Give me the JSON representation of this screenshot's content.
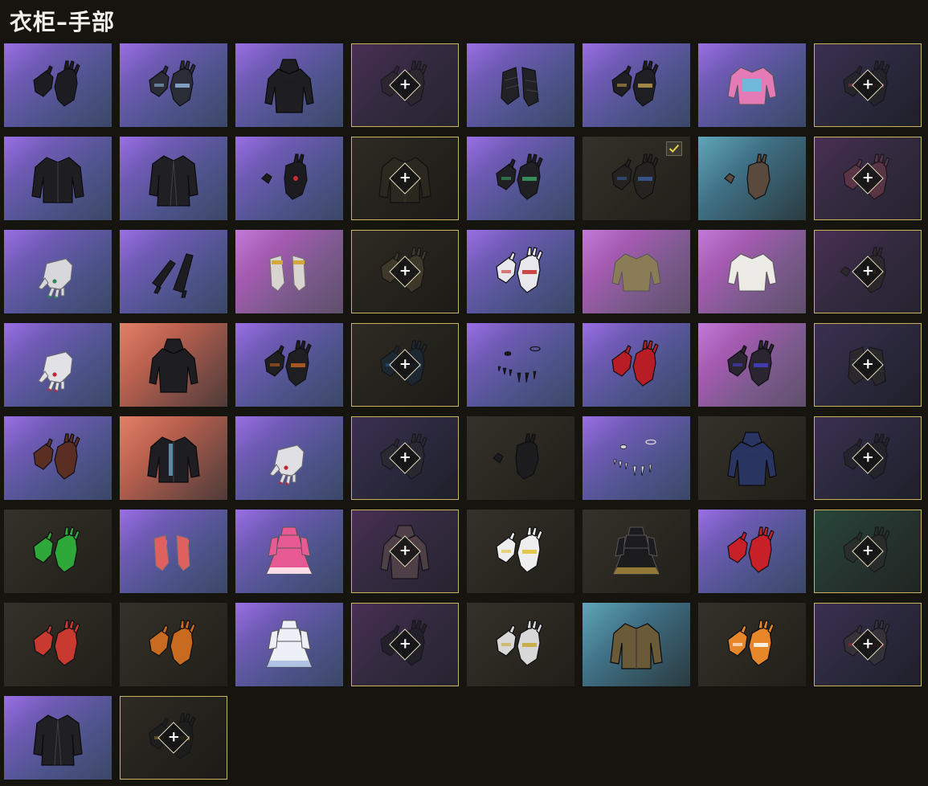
{
  "title": "衣柜–手部",
  "colors": {
    "locked_border": "#c9b45a",
    "accent_check": "#e8d046"
  },
  "items": [
    {
      "name": "black-gloves",
      "bg": "purple",
      "shape": "gloves",
      "color": "#1c1c22",
      "locked": false
    },
    {
      "name": "blue-cuff-gloves",
      "bg": "purple",
      "shape": "gloves",
      "color": "#2a2d38",
      "accent": "#8fb4d8",
      "locked": false
    },
    {
      "name": "hooded-bodysuit",
      "bg": "purple",
      "shape": "suit",
      "color": "#1d1d22",
      "locked": false
    },
    {
      "name": "locked-dark-gloves",
      "bg": "locked-purple",
      "shape": "gloves",
      "color": "#2a2528",
      "locked": true
    },
    {
      "name": "fingerless-sleeves",
      "bg": "purple",
      "shape": "sleeves",
      "color": "#222226",
      "locked": false
    },
    {
      "name": "gold-trim-gloves",
      "bg": "purple",
      "shape": "gloves",
      "color": "#1f1e22",
      "accent": "#b99a4c",
      "locked": false
    },
    {
      "name": "pink-crop-top",
      "bg": "purple",
      "shape": "top",
      "color": "#e47ab6",
      "accent": "#5dc4e0",
      "locked": false
    },
    {
      "name": "locked-ornate-gloves",
      "bg": "locked",
      "shape": "gloves",
      "color": "#232224",
      "accent": "#9a3c48",
      "locked": true
    },
    {
      "name": "black-leather-jacket",
      "bg": "purple",
      "shape": "jacket",
      "color": "#1e1e22",
      "locked": false
    },
    {
      "name": "long-black-coat",
      "bg": "purple",
      "shape": "coat",
      "color": "#1f1f24",
      "locked": false
    },
    {
      "name": "red-gem-glove",
      "bg": "purple",
      "shape": "glove-single",
      "color": "#1c1c20",
      "accent": "#c83030",
      "locked": false
    },
    {
      "name": "locked-camo-jacket",
      "bg": "locked-dark",
      "shape": "jacket",
      "color": "#2e2b22",
      "locked": true
    },
    {
      "name": "green-finger-gloves",
      "bg": "purple",
      "shape": "gloves",
      "color": "#202024",
      "accent": "#39a060",
      "locked": false
    },
    {
      "name": "gold-studded-gloves",
      "bg": "dark",
      "shape": "gloves",
      "color": "#24231f",
      "accent": "#3a5a9a",
      "locked": false,
      "equipped": true
    },
    {
      "name": "tan-fingerless-gloves",
      "bg": "teal",
      "shape": "glove-single",
      "color": "#5a4a3e",
      "locked": false
    },
    {
      "name": "locked-pink-gloves",
      "bg": "locked-purple",
      "shape": "gloves",
      "color": "#6a3a48",
      "locked": true
    },
    {
      "name": "white-hand-ring",
      "bg": "purple",
      "shape": "hand",
      "color": "#d8d8dc",
      "accent": "#2a8a5a",
      "locked": false
    },
    {
      "name": "long-black-gloves",
      "bg": "purple",
      "shape": "long-gloves",
      "color": "#1d1d21",
      "locked": false
    },
    {
      "name": "gold-bangle-hands",
      "bg": "pink",
      "shape": "hands",
      "color": "#d8d4d0",
      "accent": "#d4a83a",
      "locked": false
    },
    {
      "name": "locked-olive-gloves",
      "bg": "locked-dark",
      "shape": "gloves",
      "color": "#4a4230",
      "locked": true
    },
    {
      "name": "red-white-gloves",
      "bg": "purple",
      "shape": "gloves",
      "color": "#e8e8ec",
      "accent": "#c82a2a",
      "locked": false
    },
    {
      "name": "camo-tied-shirt",
      "bg": "pink",
      "shape": "top",
      "color": "#8a7c56",
      "locked": false
    },
    {
      "name": "white-tied-shirt",
      "bg": "pink",
      "shape": "top",
      "color": "#ecebe6",
      "locked": false
    },
    {
      "name": "locked-gold-wrap-glove",
      "bg": "locked-purple",
      "shape": "glove-single",
      "color": "#2a2722",
      "accent": "#9a8a4a",
      "locked": true
    },
    {
      "name": "white-hand-red-nails",
      "bg": "purple",
      "shape": "hand",
      "color": "#e2e2e6",
      "accent": "#c0283a",
      "locked": false
    },
    {
      "name": "hooded-jumpsuit",
      "bg": "orange",
      "shape": "suit",
      "color": "#1e1e22",
      "locked": false
    },
    {
      "name": "rainbow-knuckle-gloves",
      "bg": "purple",
      "shape": "gloves",
      "color": "#1f1f22",
      "accent": "#c06020",
      "locked": false
    },
    {
      "name": "locked-blue-gloves",
      "bg": "locked-dark",
      "shape": "gloves",
      "color": "#1a2a3c",
      "accent": "#2c6ab0",
      "locked": true
    },
    {
      "name": "claw-nails",
      "bg": "purple",
      "shape": "nails",
      "color": "#1a1a1e",
      "locked": false
    },
    {
      "name": "red-latex-gloves",
      "bg": "purple",
      "shape": "gloves",
      "color": "#b81c24",
      "locked": false
    },
    {
      "name": "purple-tip-gloves",
      "bg": "pink",
      "shape": "gloves",
      "color": "#2a2530",
      "accent": "#4a40c8",
      "locked": false
    },
    {
      "name": "locked-arm-guards",
      "bg": "locked",
      "shape": "sleeves",
      "color": "#2a2825",
      "locked": true
    },
    {
      "name": "brown-strap-gloves",
      "bg": "purple",
      "shape": "gloves",
      "color": "#5a2e22",
      "locked": false
    },
    {
      "name": "scarf-jacket",
      "bg": "orange",
      "shape": "jacket",
      "color": "#1e1e22",
      "accent": "#6ea0c8",
      "locked": false
    },
    {
      "name": "white-hand-ring-2",
      "bg": "purple",
      "shape": "hand",
      "color": "#e0e0e4",
      "accent": "#c0283a",
      "locked": false
    },
    {
      "name": "locked-grey-gloves",
      "bg": "locked",
      "shape": "gloves",
      "color": "#2a2a2e",
      "locked": true
    },
    {
      "name": "studded-fingerless",
      "bg": "dark",
      "shape": "glove-single",
      "color": "#1c1c1e",
      "locked": false
    },
    {
      "name": "tiny-claws",
      "bg": "purple",
      "shape": "nails",
      "color": "#d0d0d4",
      "locked": false
    },
    {
      "name": "hooded-dress",
      "bg": "dark",
      "shape": "suit",
      "color": "#2a3460",
      "locked": false
    },
    {
      "name": "locked-black-gloves",
      "bg": "locked",
      "shape": "gloves",
      "color": "#222226",
      "locked": true
    },
    {
      "name": "green-gloves",
      "bg": "dark",
      "shape": "gloves",
      "color": "#2ea838",
      "locked": false
    },
    {
      "name": "red-hands",
      "bg": "purple",
      "shape": "hands",
      "color": "#e06060",
      "locked": false
    },
    {
      "name": "pink-dress",
      "bg": "purple",
      "shape": "dress",
      "color": "#e85a94",
      "accent": "#ffffff",
      "locked": false
    },
    {
      "name": "locked-armored-sleeves",
      "bg": "locked-purple",
      "shape": "suit",
      "color": "#5a4a4a",
      "accent": "#c04040",
      "locked": true
    },
    {
      "name": "white-gold-gloves",
      "bg": "dark",
      "shape": "gloves",
      "color": "#eeeeee",
      "accent": "#e0c030",
      "locked": false
    },
    {
      "name": "black-gold-dress",
      "bg": "dark",
      "shape": "dress",
      "color": "#1c1c1e",
      "accent": "#b0903c",
      "locked": false
    },
    {
      "name": "red-studded-gloves",
      "bg": "purple",
      "shape": "gloves",
      "color": "#c82028",
      "locked": false
    },
    {
      "name": "locked-mesh-gloves",
      "bg": "locked-green",
      "shape": "gloves",
      "color": "#2a2a2a",
      "locked": true
    },
    {
      "name": "red-racing-gloves",
      "bg": "dark",
      "shape": "gloves",
      "color": "#c83a30",
      "locked": false
    },
    {
      "name": "orange-racing-gloves",
      "bg": "dark",
      "shape": "gloves",
      "color": "#c86a20",
      "locked": false
    },
    {
      "name": "white-frill-dress",
      "bg": "purple",
      "shape": "dress",
      "color": "#eef0f8",
      "accent": "#a0b8e0",
      "locked": false
    },
    {
      "name": "locked-black-gloves-2",
      "bg": "locked-purple",
      "shape": "gloves",
      "color": "#1c1c20",
      "locked": true
    },
    {
      "name": "white-yellow-gloves",
      "bg": "dark",
      "shape": "gloves",
      "color": "#d8d8d8",
      "accent": "#c8a830",
      "locked": false
    },
    {
      "name": "leopard-jacket",
      "bg": "teal",
      "shape": "jacket",
      "color": "#6a5a38",
      "locked": false
    },
    {
      "name": "orange-white-gloves",
      "bg": "dark",
      "shape": "gloves",
      "color": "#e8862a",
      "accent": "#ffffff",
      "locked": false
    },
    {
      "name": "locked-red-grey-gloves",
      "bg": "locked",
      "shape": "gloves",
      "color": "#3a3638",
      "accent": "#b02a2a",
      "locked": true
    },
    {
      "name": "black-trench-jacket",
      "bg": "purple",
      "shape": "coat",
      "color": "#1f1f24",
      "locked": false
    },
    {
      "name": "locked-gold-black-gloves",
      "bg": "locked-dark",
      "shape": "gloves",
      "color": "#1c1c1e",
      "accent": "#b08a30",
      "locked": true
    }
  ]
}
